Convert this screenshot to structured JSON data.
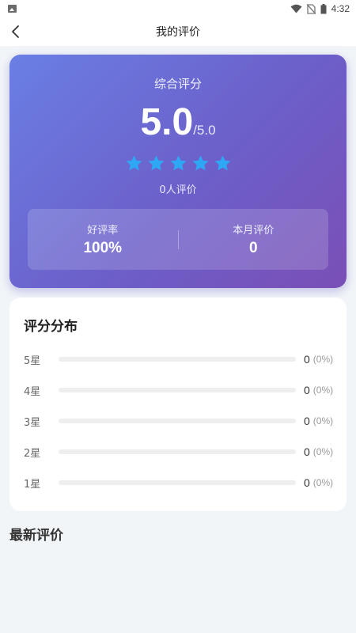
{
  "status_bar": {
    "time": "4:32"
  },
  "header": {
    "title": "我的评价"
  },
  "summary": {
    "label": "综合评分",
    "score": "5.0",
    "max": "/5.0",
    "stars": 5,
    "review_count": "0人评价",
    "stats": [
      {
        "label": "好评率",
        "value": "100%"
      },
      {
        "label": "本月评价",
        "value": "0"
      }
    ]
  },
  "distribution": {
    "title": "评分分布",
    "rows": [
      {
        "label": "5星",
        "count": "0",
        "pct": "(0%)",
        "fraction": 0
      },
      {
        "label": "4星",
        "count": "0",
        "pct": "(0%)",
        "fraction": 0
      },
      {
        "label": "3星",
        "count": "0",
        "pct": "(0%)",
        "fraction": 0
      },
      {
        "label": "2星",
        "count": "0",
        "pct": "(0%)",
        "fraction": 0
      },
      {
        "label": "1星",
        "count": "0",
        "pct": "(0%)",
        "fraction": 0
      }
    ]
  },
  "latest": {
    "title": "最新评价"
  },
  "colors": {
    "star": "#2ea8f5",
    "bar_track": "#eeeeee",
    "card_gradient_start": "#6a7fe4",
    "card_gradient_end": "#7a4fb6"
  },
  "icons": {
    "back": "chevron-left-icon",
    "star": "star-icon"
  }
}
